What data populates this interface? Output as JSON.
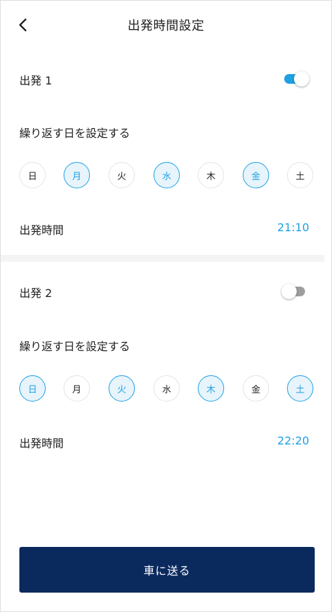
{
  "header": {
    "title": "出発時間設定",
    "back_icon": "chevron-left-icon"
  },
  "departures": [
    {
      "label": "出発 1",
      "enabled": true,
      "repeat_label": "繰り返す日を設定する",
      "days": [
        {
          "label": "日",
          "selected": false
        },
        {
          "label": "月",
          "selected": true
        },
        {
          "label": "火",
          "selected": false
        },
        {
          "label": "水",
          "selected": true
        },
        {
          "label": "木",
          "selected": false
        },
        {
          "label": "金",
          "selected": true
        },
        {
          "label": "土",
          "selected": false
        }
      ],
      "time_label": "出発時間",
      "time_value": "21:10"
    },
    {
      "label": "出発 2",
      "enabled": false,
      "repeat_label": "繰り返す日を設定する",
      "days": [
        {
          "label": "日",
          "selected": true
        },
        {
          "label": "月",
          "selected": false
        },
        {
          "label": "火",
          "selected": true
        },
        {
          "label": "水",
          "selected": false
        },
        {
          "label": "木",
          "selected": true
        },
        {
          "label": "金",
          "selected": false
        },
        {
          "label": "土",
          "selected": true
        }
      ],
      "time_label": "出発時間",
      "time_value": "22:20"
    }
  ],
  "footer": {
    "send_label": "車に送る"
  },
  "colors": {
    "accent": "#1ea0e3",
    "selected_day_bg": "#e7f4fb",
    "button_bg": "#0a2a5e",
    "toggle_off": "#9e9e9e"
  }
}
